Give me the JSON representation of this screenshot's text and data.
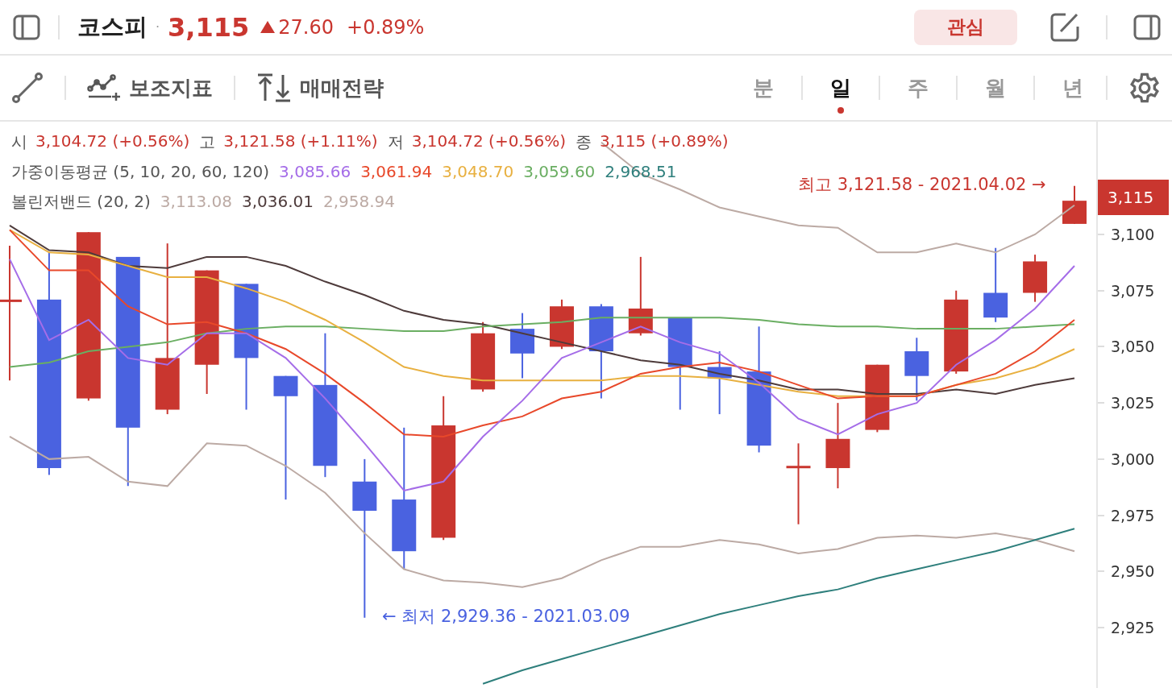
{
  "header": {
    "title": "코스피",
    "separator": "·",
    "price": "3,115",
    "rising": true,
    "change": "27.60",
    "change_pct": "+0.89%",
    "watch_button": "관심"
  },
  "toolbar": {
    "tools": [
      {
        "kind": "indicator",
        "label": "보조지표"
      },
      {
        "kind": "strategy",
        "label": "매매전략"
      }
    ],
    "periods": [
      {
        "label": "분",
        "selected": false
      },
      {
        "label": "일",
        "selected": true
      },
      {
        "label": "주",
        "selected": false
      },
      {
        "label": "월",
        "selected": false
      },
      {
        "label": "년",
        "selected": false
      }
    ]
  },
  "ohlc": [
    {
      "label": "시",
      "value": "3,104.72 (+0.56%)"
    },
    {
      "label": "고",
      "value": "3,121.58 (+1.11%)"
    },
    {
      "label": "저",
      "value": "3,104.72 (+0.56%)"
    },
    {
      "label": "종",
      "value": "3,115 (+0.89%)"
    }
  ],
  "moving_average": {
    "label": "가중이동평균 (5, 10, 20, 60, 120)",
    "values": [
      {
        "value": "3,085.66",
        "color": "#a56de8"
      },
      {
        "value": "3,061.94",
        "color": "#e8482a"
      },
      {
        "value": "3,048.70",
        "color": "#e8b040"
      },
      {
        "value": "3,059.60",
        "color": "#6aae62"
      },
      {
        "value": "2,968.51",
        "color": "#2e7f7c"
      }
    ]
  },
  "bollinger": {
    "label": "볼린저밴드 (20, 2)",
    "values": [
      {
        "value": "3,113.08",
        "color": "#bcaaa4"
      },
      {
        "value": "3,036.01",
        "color": "#4e3b3b"
      },
      {
        "value": "2,958.94",
        "color": "#bcaaa4"
      }
    ]
  },
  "annotations": {
    "high": "최고 3,121.58 - 2021.04.02 →",
    "low": "← 최저 2,929.36 - 2021.03.09"
  },
  "price_axis": {
    "current": "3,115"
  },
  "chart_data": {
    "type": "line",
    "categories": [
      null,
      null,
      null,
      null,
      null,
      null,
      null,
      null,
      null,
      null,
      null,
      null,
      null,
      null,
      null,
      null,
      null,
      null,
      null,
      null,
      null,
      null,
      null,
      null,
      null,
      null,
      null,
      null
    ],
    "ylim": [
      2897.4,
      3150.2
    ],
    "yticks": [
      {
        "value": 3100,
        "label": "3,100"
      },
      {
        "value": 3075,
        "label": "3,075"
      },
      {
        "value": 3050,
        "label": "3,050"
      },
      {
        "value": 3025,
        "label": "3,025"
      },
      {
        "value": 3000,
        "label": "3,000"
      },
      {
        "value": 2975,
        "label": "2,975"
      },
      {
        "value": 2950,
        "label": "2,950"
      },
      {
        "value": 2925,
        "label": "2,925"
      }
    ],
    "series": [
      {
        "color": "#bcaaa4",
        "values": [
          null,
          null,
          null,
          null,
          null,
          null,
          null,
          null,
          null,
          null,
          null,
          null,
          null,
          null,
          null,
          3141,
          3127,
          3120,
          3112,
          3108,
          3104,
          3103,
          3092,
          3092,
          3096,
          3092,
          3100,
          3113
        ]
      },
      {
        "color": "#bcaaa4",
        "values": [
          3010,
          3000,
          3001,
          2990,
          2988,
          3007,
          3006,
          2997,
          2985,
          2967,
          2951,
          2946,
          2945,
          2943,
          2947,
          2955,
          2961,
          2961,
          2964,
          2962,
          2958,
          2960,
          2965,
          2966,
          2965,
          2967,
          2964,
          2959
        ]
      },
      {
        "color": "#4e3b3b",
        "values": [
          3104,
          3093,
          3092,
          3086,
          3085,
          3090,
          3090,
          3086,
          3079,
          3073,
          3066,
          3062,
          3060,
          3056,
          3052,
          3048,
          3044,
          3042,
          3038,
          3035,
          3031,
          3031,
          3029,
          3029,
          3031,
          3029,
          3033,
          3036
        ]
      },
      {
        "color": "#6aae62",
        "values": [
          3041,
          3043,
          3048,
          3050,
          3052,
          3056,
          3058,
          3059,
          3059,
          3058,
          3057,
          3057,
          3059,
          3060,
          3061,
          3063,
          3063,
          3063,
          3063,
          3062,
          3060,
          3059,
          3059,
          3058,
          3058,
          3058,
          3059,
          3060
        ]
      },
      {
        "color": "#e8b040",
        "values": [
          3102,
          3092,
          3091,
          3086,
          3081,
          3081,
          3076,
          3070,
          3062,
          3052,
          3041,
          3037,
          3035,
          3035,
          3035,
          3035,
          3037,
          3037,
          3036,
          3033,
          3030,
          3028,
          3028,
          3028,
          3033,
          3036,
          3041,
          3049
        ]
      },
      {
        "color": "#e8482a",
        "values": [
          3102,
          3084,
          3084,
          3068,
          3060,
          3061,
          3056,
          3049,
          3038,
          3025,
          3011,
          3010,
          3015,
          3019,
          3027,
          3030,
          3038,
          3041,
          3043,
          3039,
          3033,
          3027,
          3028,
          3028,
          3033,
          3038,
          3048,
          3062
        ]
      },
      {
        "color": "#a56de8",
        "values": [
          3089,
          3053,
          3062,
          3045,
          3042,
          3056,
          3056,
          3045,
          3027,
          3007,
          2986,
          2990,
          3010,
          3026,
          3045,
          3052,
          3059,
          3052,
          3047,
          3034,
          3018,
          3011,
          3020,
          3025,
          3042,
          3053,
          3067,
          3086
        ]
      },
      {
        "color": "#2e7f7c",
        "values": [
          null,
          null,
          null,
          null,
          null,
          null,
          null,
          null,
          null,
          null,
          null,
          null,
          2900,
          2906,
          2911,
          2916,
          2921,
          2926,
          2931,
          2935,
          2939,
          2942,
          2947,
          2951,
          2955,
          2959,
          2964,
          2969
        ]
      }
    ]
  }
}
